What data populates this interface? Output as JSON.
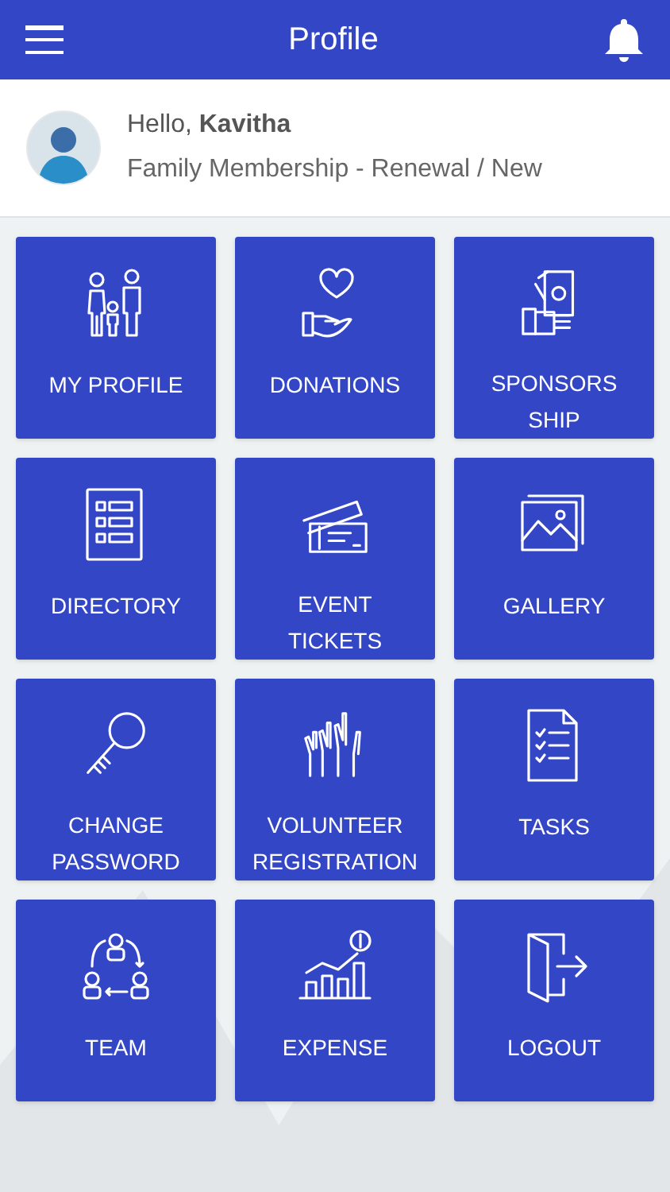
{
  "app_bar": {
    "title": "Profile"
  },
  "profile": {
    "greeting": "Hello, **Kavitha**",
    "membership": "Family Membership - Renewal / New"
  },
  "tiles": [
    {
      "label": [
        "MY PROFILE"
      ]
    },
    {
      "label": [
        "DONATIONS"
      ]
    },
    {
      "label": [
        "SPONSORS",
        "SHIP"
      ]
    },
    {
      "label": [
        "DIRECTORY"
      ]
    },
    {
      "label": [
        "EVENT",
        "TICKETS"
      ]
    },
    {
      "label": [
        "GALLERY"
      ]
    },
    {
      "label": [
        "CHANGE",
        "PASSWORD"
      ]
    },
    {
      "label": [
        "VOLUNTEER",
        "REGISTRATION"
      ]
    },
    {
      "label": [
        "TASKS"
      ]
    },
    {
      "label": [
        "TEAM"
      ]
    },
    {
      "label": [
        "EXPENSE"
      ]
    },
    {
      "label": [
        "LOGOUT"
      ]
    }
  ]
}
